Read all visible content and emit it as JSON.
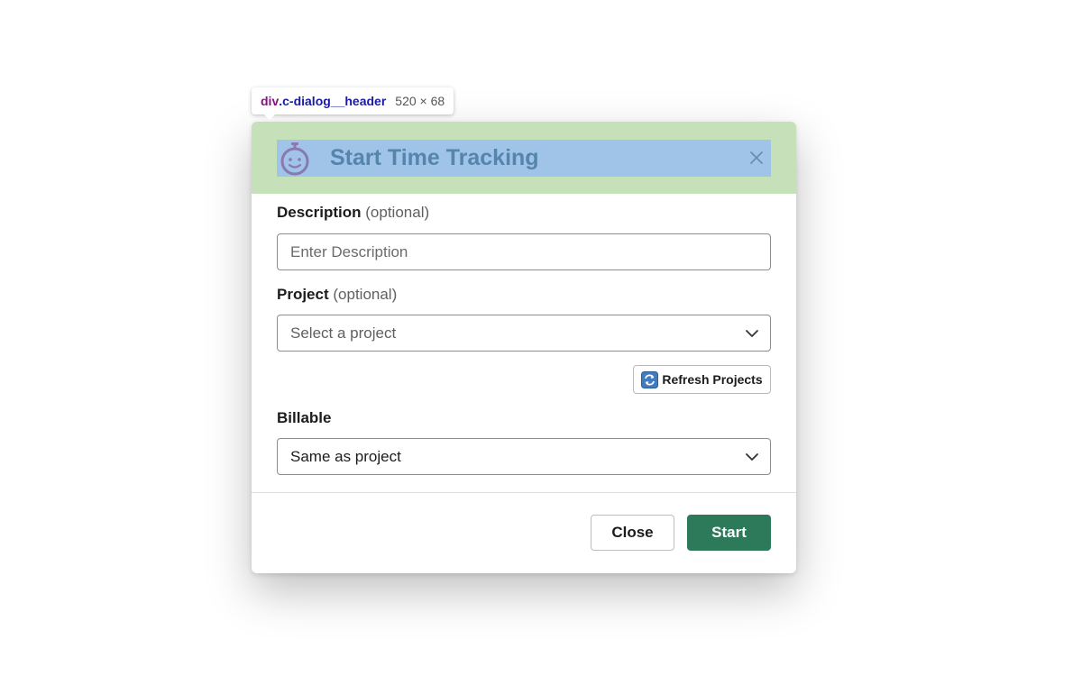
{
  "inspector_tooltip": {
    "tag": "div",
    "class_name": ".c-dialog__header",
    "dimensions": "520 × 68"
  },
  "dialog": {
    "title": "Start Time Tracking",
    "header_icon": "stopwatch-icon",
    "close_icon": "close-icon",
    "description": {
      "label": "Description",
      "optional": "(optional)",
      "placeholder": "Enter Description",
      "value": ""
    },
    "project": {
      "label": "Project",
      "optional": "(optional)",
      "placeholder": "Select a project"
    },
    "refresh_button": {
      "label": "Refresh Projects",
      "icon": "refresh-icon"
    },
    "billable": {
      "label": "Billable",
      "selected": "Same as project"
    },
    "footer": {
      "close_label": "Close",
      "start_label": "Start"
    }
  },
  "colors": {
    "header_highlight_margin": "#c6e0b9",
    "header_highlight_content": "#a0c4e7",
    "title_text": "#5585ad",
    "icon_color": "#8a78b0",
    "primary_button": "#2d7a5a"
  }
}
